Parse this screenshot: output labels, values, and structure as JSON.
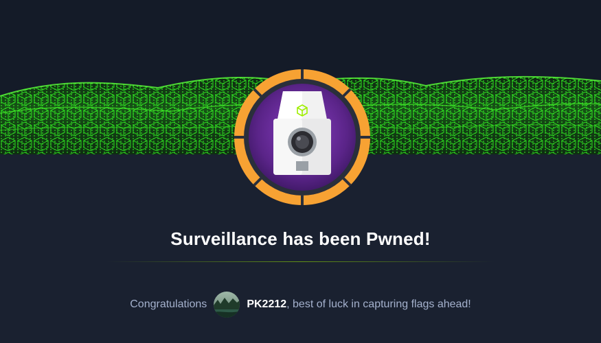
{
  "banner": {
    "pattern_color": "#26d31a",
    "background_color": "#111927"
  },
  "badge": {
    "ring_color": "#f7a233",
    "inner_color": "#6a2c9e",
    "icon": "security-camera-icon"
  },
  "title": {
    "machine_name": "Surveillance",
    "text": "Surveillance has been Pwned!"
  },
  "congrats": {
    "prefix": "Congratulations",
    "username": "PK2212",
    "suffix": ", best of luck in capturing flags ahead!",
    "avatar_icon": "user-avatar-icon"
  },
  "colors": {
    "page_background": "#1a2130",
    "accent_green": "#9fef00",
    "text_muted": "#a4b1cd",
    "text_white": "#ffffff"
  }
}
